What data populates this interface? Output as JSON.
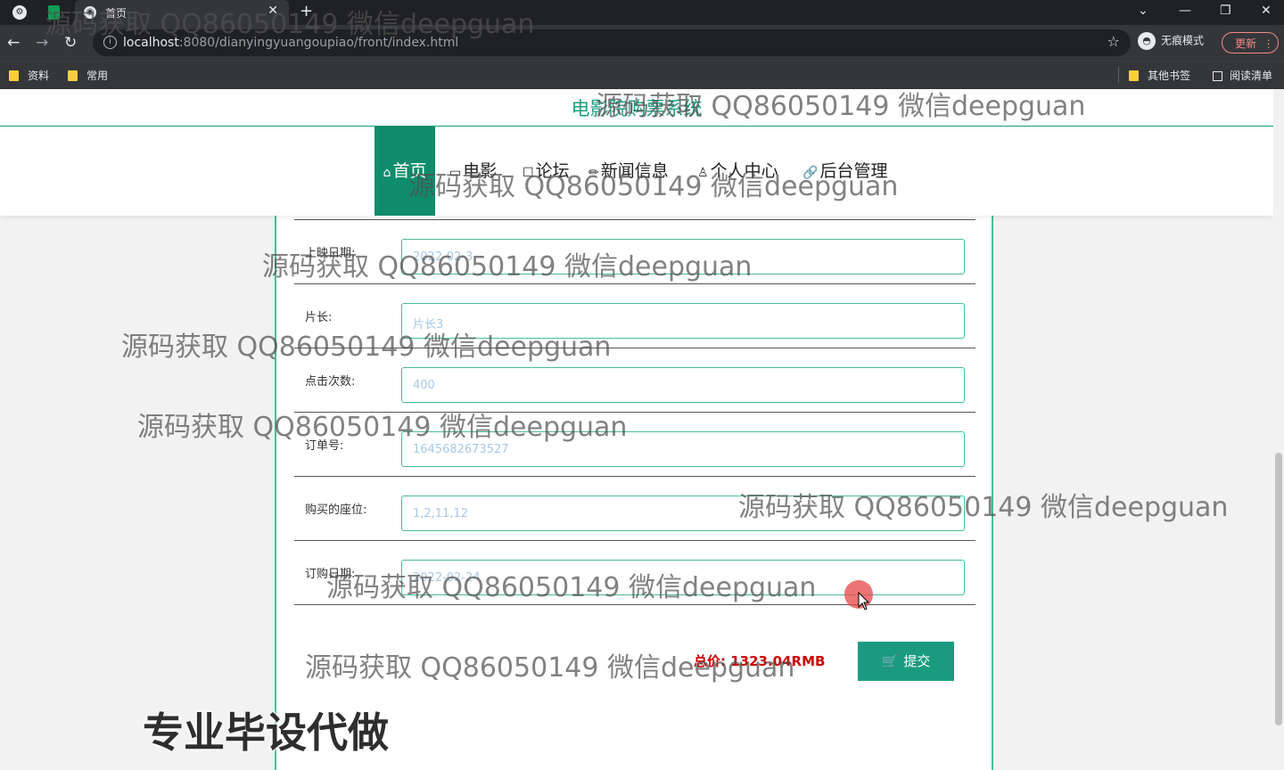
{
  "browser": {
    "tab_title": "首页",
    "url_host": "localhost",
    "url_rest": ":8080/dianyingyuangoupiao/front/index.html",
    "incognito_label": "无痕模式",
    "update_label": "更新",
    "bookmarks": [
      "资料",
      "常用"
    ],
    "other_bookmarks": "其他书签",
    "reading_list": "阅读清单"
  },
  "site": {
    "title": "电影院购票系统",
    "nav": [
      {
        "icon": "⌂",
        "label": "首页"
      },
      {
        "icon": "▭",
        "label": "电影"
      },
      {
        "icon": "☐",
        "label": "论坛"
      },
      {
        "icon": "✏",
        "label": "新闻信息"
      },
      {
        "icon": "♙",
        "label": "个人中心"
      },
      {
        "icon": "🔗",
        "label": "后台管理"
      }
    ]
  },
  "form": {
    "fields": [
      {
        "label": "上映日期:",
        "value": "2022-02-3"
      },
      {
        "label": "片长:",
        "value": "片长3"
      },
      {
        "label": "点击次数:",
        "value": "400"
      },
      {
        "label": "订单号:",
        "value": "1645682673527"
      },
      {
        "label": "购买的座位:",
        "value": "1,2,11,12"
      },
      {
        "label": "订购日期:",
        "value": "2022-02-24"
      }
    ],
    "total": "总价: 1323.04RMB",
    "submit_label": "提交"
  },
  "overlay": {
    "watermark": "源码获取 QQ86050149 微信deepguan",
    "promo": "专业毕设代做"
  }
}
